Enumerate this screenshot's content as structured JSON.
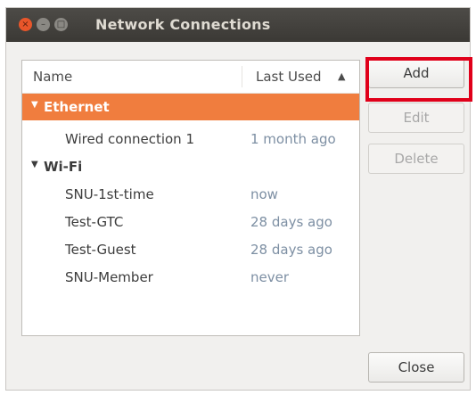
{
  "window": {
    "title": "Network Connections",
    "buttons": {
      "close": "×",
      "minimize": "–",
      "maximize": "□"
    }
  },
  "list": {
    "columns": {
      "name": "Name",
      "last_used": "Last Used",
      "sort_indicator": "▲"
    },
    "groups": [
      {
        "label": "Ethernet",
        "expander": "▼",
        "selected": true,
        "connections": [
          {
            "name": "Wired connection 1",
            "last_used": "1 month ago"
          }
        ]
      },
      {
        "label": "Wi-Fi",
        "expander": "▼",
        "selected": false,
        "connections": [
          {
            "name": "SNU-1st-time",
            "last_used": "now"
          },
          {
            "name": "Test-GTC",
            "last_used": "28 days ago"
          },
          {
            "name": "Test-Guest",
            "last_used": "28 days ago"
          },
          {
            "name": "SNU-Member",
            "last_used": "never"
          }
        ]
      }
    ]
  },
  "actions": {
    "add": "Add",
    "edit": "Edit",
    "delete": "Delete",
    "close": "Close"
  },
  "colors": {
    "selection": "#f07d3e",
    "annotation": "#e0001a",
    "titlebar": "#3b3935"
  }
}
